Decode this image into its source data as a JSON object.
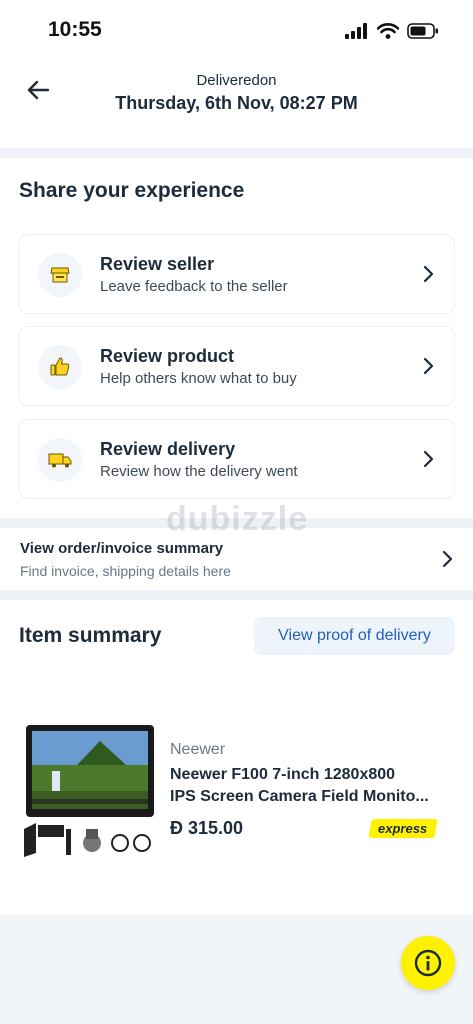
{
  "status_bar": {
    "time": "10:55"
  },
  "header": {
    "subtitle": "Deliveredon",
    "title": "Thursday, 6th Nov, 08:27 PM"
  },
  "share": {
    "title": "Share your experience",
    "items": [
      {
        "title": "Review seller",
        "desc": "Leave feedback to the seller",
        "icon": "store-icon"
      },
      {
        "title": "Review product",
        "desc": "Help others know what to buy",
        "icon": "thumbs-up-icon"
      },
      {
        "title": "Review delivery",
        "desc": "Review how the delivery went",
        "icon": "delivery-truck-icon"
      }
    ]
  },
  "watermark": "dubizzle",
  "invoice": {
    "title": "View order/invoice summary",
    "subtitle": "Find invoice, shipping details here"
  },
  "items": {
    "title": "Item summary",
    "proof_label": "View proof of delivery",
    "product": {
      "brand": "Neewer",
      "name_line1": "Neewer F100 7-inch 1280x800",
      "name_line2": "IPS Screen Camera Field Monito...",
      "price": "Đ 315.00",
      "badge": "express"
    }
  },
  "colors": {
    "accent_yellow": "#fff200",
    "link_blue": "#1f5fbf",
    "text_dark": "#1d2b3a"
  }
}
